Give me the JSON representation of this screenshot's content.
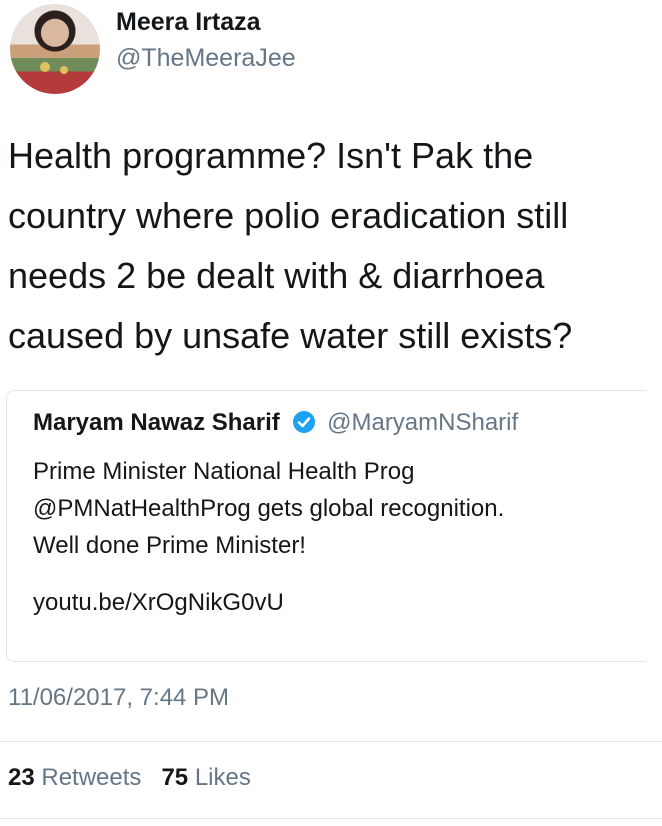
{
  "author": {
    "name": "Meera Irtaza",
    "handle": "@TheMeeraJee"
  },
  "tweet": {
    "lines": [
      "Health programme? Isn't Pak the",
      "country where polio eradication still",
      "needs 2 be dealt with & diarrhoea",
      "caused by unsafe water still exists?"
    ]
  },
  "quoted_tweet": {
    "name": "Maryam Nawaz Sharif",
    "verified": true,
    "handle": "@MaryamNSharif",
    "lines": [
      "Prime Minister National Health Prog",
      "@PMNatHealthProg gets global recognition.",
      "Well done Prime Minister!"
    ],
    "link": "youtu.be/XrOgNikG0vU"
  },
  "timestamp": "11/06/2017, 7:44 PM",
  "stats": {
    "retweets_count": "23",
    "retweets_label": "Retweets",
    "likes_count": "75",
    "likes_label": "Likes"
  },
  "colors": {
    "text": "#14171a",
    "secondary": "#657786",
    "verified": "#1da1f2",
    "divider": "#e1e8ed"
  }
}
